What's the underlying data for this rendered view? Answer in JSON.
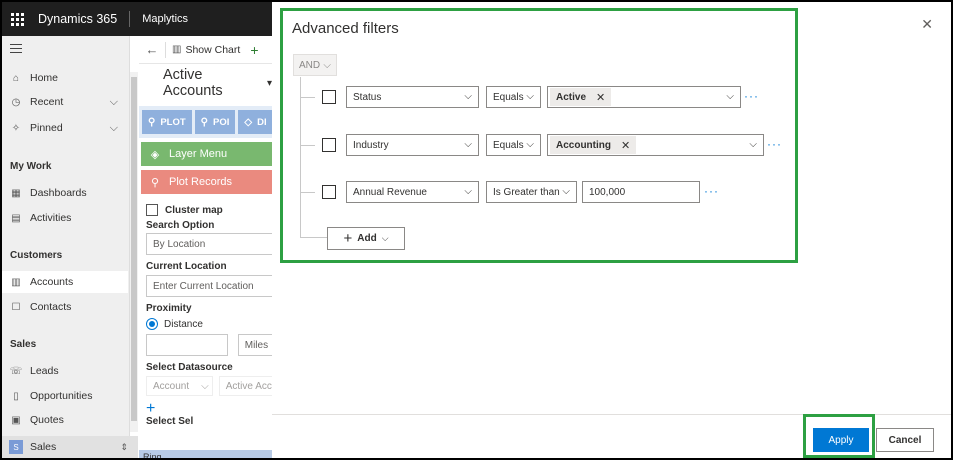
{
  "topbar": {
    "app_name": "Dynamics 365",
    "module_name": "Maplytics"
  },
  "nav": {
    "items": [
      {
        "label": "Home",
        "icon": "home-icon"
      },
      {
        "label": "Recent",
        "icon": "clock-icon"
      },
      {
        "label": "Pinned",
        "icon": "pin-icon"
      }
    ],
    "my_work": {
      "title": "My Work",
      "items": [
        "Dashboards",
        "Activities"
      ]
    },
    "customers": {
      "title": "Customers",
      "items": [
        "Accounts",
        "Contacts"
      ]
    },
    "sales": {
      "title": "Sales",
      "items": [
        "Leads",
        "Opportunities",
        "Quotes"
      ]
    },
    "area_switcher": {
      "badge": "S",
      "label": "Sales"
    }
  },
  "midpanel": {
    "show_chart": "Show Chart",
    "view_title": "Active Accounts",
    "tabs": [
      "PLOT",
      "POI",
      "DI"
    ],
    "layer_menu": "Layer Menu",
    "plot_records": "Plot Records",
    "cluster_map": "Cluster map",
    "search_option_label": "Search Option",
    "search_option_value": "By Location",
    "current_location_label": "Current Location",
    "current_location_placeholder": "Enter Current Location",
    "proximity_label": "Proximity",
    "distance_label": "Distance",
    "miles": "Miles",
    "datasource_label": "Select Datasource",
    "datasource_entity": "Account",
    "datasource_view": "Active Acc",
    "truncated_label": "Select Sel",
    "bottom_strip_text": "Ring"
  },
  "dialog": {
    "title": "Advanced filters",
    "group_operator": "AND",
    "rows": [
      {
        "field": "Status",
        "operator": "Equals",
        "value_tag": "Active"
      },
      {
        "field": "Industry",
        "operator": "Equals",
        "value_tag": "Accounting"
      },
      {
        "field": "Annual Revenue",
        "operator": "Is Greater than",
        "value_text": "100,000"
      }
    ],
    "add_label": "Add",
    "apply_label": "Apply",
    "cancel_label": "Cancel"
  },
  "colors": {
    "highlight": "#2da042",
    "primary": "#0078d4",
    "topbar": "#1f1f1f",
    "layer_menu": "#79b86f",
    "plot_records": "#ea8a7f"
  }
}
